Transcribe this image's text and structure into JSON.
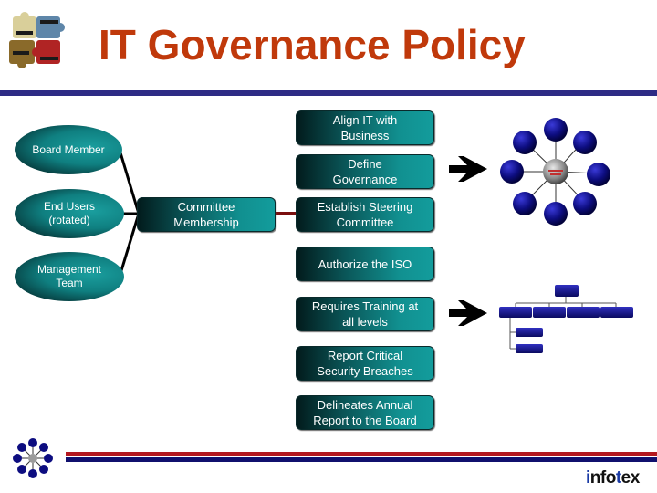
{
  "slide": {
    "title": "IT Governance Policy",
    "colors": {
      "title": "#c0390b",
      "title_rule": "#2e2b85",
      "box_teal": "#139c9c",
      "box_dark": "#021b1c",
      "connector": "#000000",
      "link_red": "#7a0f0f",
      "hub_node": "#0d0d80",
      "hub_center": "#8a8a8a",
      "footer_red": "#b3181f",
      "footer_navy": "#10106e"
    }
  },
  "stakeholders": [
    {
      "label": "Board Member"
    },
    {
      "label": "End Users (rotated)"
    },
    {
      "label": "Management Team"
    }
  ],
  "committee": {
    "label": "Committee Membership"
  },
  "policy_steps": [
    {
      "label": "Align IT with Business"
    },
    {
      "label": "Define Governance"
    },
    {
      "label": "Establish Steering Committee"
    },
    {
      "label": "Authorize the ISO"
    },
    {
      "label": "Requires Training at all levels"
    },
    {
      "label": "Report Critical Security Breaches"
    },
    {
      "label": "Delineates Annual Report to the Board"
    }
  ],
  "icons": {
    "logo": "puzzle-pieces-logo",
    "arrow": "right-arrow-icon",
    "hub_diagram": "governance-hub-diagram",
    "org_chart": "training-org-chart",
    "footer_hub": "hub-icon"
  },
  "footer": {
    "brand_parts": [
      "i",
      "nfo",
      "t",
      "ex"
    ]
  }
}
